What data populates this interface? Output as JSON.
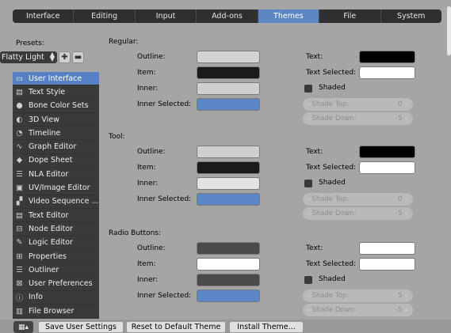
{
  "tabs": [
    {
      "label": "Interface",
      "active": false
    },
    {
      "label": "Editing",
      "active": false
    },
    {
      "label": "Input",
      "active": false
    },
    {
      "label": "Add-ons",
      "active": false
    },
    {
      "label": "Themes",
      "active": true
    },
    {
      "label": "File",
      "active": false
    },
    {
      "label": "System",
      "active": false
    }
  ],
  "presets": {
    "label": "Presets:",
    "value": "Flatty Light"
  },
  "sidebar": {
    "items": [
      {
        "label": "User Interface",
        "icon": "user-interface-icon",
        "active": true
      },
      {
        "label": "Text Style",
        "icon": "text-style-icon"
      },
      {
        "label": "Bone Color Sets",
        "icon": "bone-icon"
      },
      {
        "label": "3D View",
        "icon": "view3d-icon"
      },
      {
        "label": "Timeline",
        "icon": "timeline-icon"
      },
      {
        "label": "Graph Editor",
        "icon": "graph-icon"
      },
      {
        "label": "Dope Sheet",
        "icon": "dopesheet-icon"
      },
      {
        "label": "NLA Editor",
        "icon": "nla-icon"
      },
      {
        "label": "UV/Image Editor",
        "icon": "image-icon"
      },
      {
        "label": "Video Sequence ...",
        "icon": "sequence-icon"
      },
      {
        "label": "Text Editor",
        "icon": "text-editor-icon"
      },
      {
        "label": "Node Editor",
        "icon": "node-icon"
      },
      {
        "label": "Logic Editor",
        "icon": "logic-icon"
      },
      {
        "label": "Properties",
        "icon": "properties-icon"
      },
      {
        "label": "Outliner",
        "icon": "outliner-icon"
      },
      {
        "label": "User Preferences",
        "icon": "preferences-icon"
      },
      {
        "label": "Info",
        "icon": "info-icon"
      },
      {
        "label": "File Browser",
        "icon": "file-browser-icon"
      }
    ]
  },
  "sections": [
    {
      "title": "Regular:",
      "outline": "Outline:",
      "item": "Item:",
      "inner": "Inner:",
      "inner_selected": "Inner Selected:",
      "colors": {
        "outline": "#d2d2d2",
        "item": "#1a1a1a",
        "inner": "#cfcfcf",
        "inner_selected": "#5b86c8",
        "text": "#000000",
        "text_selected": "#ffffff"
      },
      "text": "Text:",
      "text_selected": "Text Selected:",
      "shaded": "Shaded",
      "shade_top": {
        "label": "Shade Top:",
        "value": "0"
      },
      "shade_down": {
        "label": "Shade Down:",
        "value": "-5"
      }
    },
    {
      "title": "Tool:",
      "outline": "Outline:",
      "item": "Item:",
      "inner": "Inner:",
      "inner_selected": "Inner Selected:",
      "colors": {
        "outline": "#cfcfcf",
        "item": "#1a1a1a",
        "inner": "#e3e3e3",
        "inner_selected": "#5b86c8",
        "text": "#000000",
        "text_selected": "#ffffff"
      },
      "text": "Text:",
      "text_selected": "Text Selected:",
      "shaded": "Shaded",
      "shade_top": {
        "label": "Shade Top:",
        "value": "0"
      },
      "shade_down": {
        "label": "Shade Down:",
        "value": "-5"
      }
    },
    {
      "title": "Radio Buttons:",
      "outline": "Outline:",
      "item": "Item:",
      "inner": "Inner:",
      "inner_selected": "Inner Selected:",
      "colors": {
        "outline": "#4a4a4a",
        "item": "#ffffff",
        "inner": "#4a4a4a",
        "inner_selected": "#5b86c8",
        "text": "#ffffff",
        "text_selected": "#ffffff"
      },
      "text": "Text:",
      "text_selected": "Text Selected:",
      "shaded": "Shaded",
      "shade_top": {
        "label": "Shade Top:",
        "value": "5"
      },
      "shade_down": {
        "label": "Shade Down:",
        "value": "-5"
      }
    }
  ],
  "bottom": {
    "save": "Save User Settings",
    "reset": "Reset to Default Theme",
    "install": "Install Theme..."
  }
}
